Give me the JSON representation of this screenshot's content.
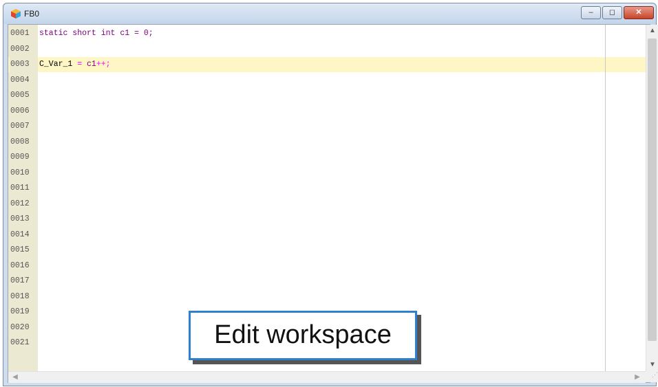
{
  "window": {
    "title": "FB0",
    "controls": {
      "minimize": "–",
      "maximize": "◻",
      "close": "✕"
    }
  },
  "editor": {
    "lines": [
      {
        "num": "0001",
        "parts": [
          {
            "t": "static short int c1 = 0;",
            "c": "kw"
          }
        ]
      },
      {
        "num": "0002",
        "parts": []
      },
      {
        "num": "0003",
        "parts": [
          {
            "t": "C_Var_1 ",
            "c": ""
          },
          {
            "t": "=",
            "c": "op"
          },
          {
            "t": " c1",
            "c": "kw"
          },
          {
            "t": "++;",
            "c": "op"
          }
        ],
        "highlight": true
      },
      {
        "num": "0004",
        "parts": []
      },
      {
        "num": "0005",
        "parts": []
      },
      {
        "num": "0006",
        "parts": []
      },
      {
        "num": "0007",
        "parts": []
      },
      {
        "num": "0008",
        "parts": []
      },
      {
        "num": "0009",
        "parts": []
      },
      {
        "num": "0010",
        "parts": []
      },
      {
        "num": "0011",
        "parts": []
      },
      {
        "num": "0012",
        "parts": []
      },
      {
        "num": "0013",
        "parts": []
      },
      {
        "num": "0014",
        "parts": []
      },
      {
        "num": "0015",
        "parts": []
      },
      {
        "num": "0016",
        "parts": []
      },
      {
        "num": "0017",
        "parts": []
      },
      {
        "num": "0018",
        "parts": []
      },
      {
        "num": "0019",
        "parts": []
      },
      {
        "num": "0020",
        "parts": []
      },
      {
        "num": "0021",
        "parts": []
      }
    ]
  },
  "callout": {
    "label": "Edit workspace"
  },
  "colors": {
    "callout_border": "#2d7fd2",
    "highlight_line": "#fef6c4",
    "keyword": "#800080",
    "operator": "#ff00ff"
  }
}
